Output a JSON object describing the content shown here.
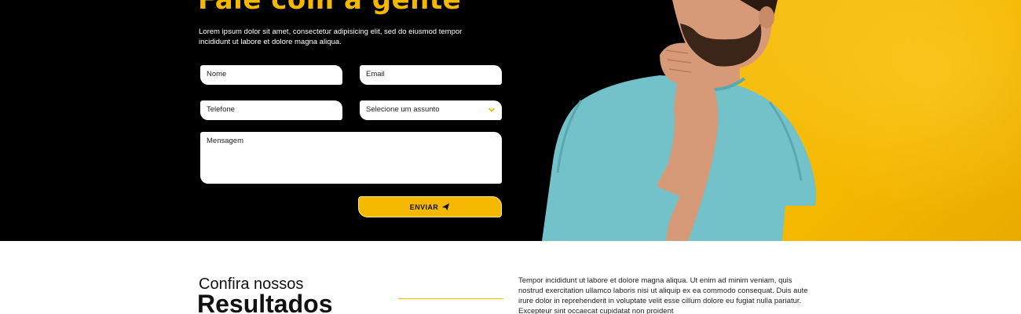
{
  "contact": {
    "title": "Fale com a gente",
    "description": "Lorem ipsum dolor sit amet, consectetur adipisicing elit, sed do eiusmod tempor incididunt ut labore et dolore magna aliqua.",
    "fields": {
      "name_placeholder": "Nome",
      "email_placeholder": "Email",
      "phone_placeholder": "Telefone",
      "subject_placeholder": "Selecione um assunto",
      "message_placeholder": "Mensagem"
    },
    "submit_label": "ENVIAR",
    "submit_icon": "paper-plane-icon"
  },
  "results": {
    "pretitle": "Confira nossos",
    "title": "Resultados",
    "text": "Tempor incididunt ut labore et dolore magna aliqua. Ut enim ad minim veniam, quis nostrud exercitation ullamco laboris nisi ut aliquip ex ea commodo consequat. Duis aute irure dolor in reprehenderit in voluptate velit esse cillum dolore eu fugiat nulla pariatur. Excepteur sint occaecat cupidatat non proident"
  },
  "colors": {
    "accent": "#f5b800",
    "dark": "#000000",
    "shirt": "#74c2c9"
  }
}
